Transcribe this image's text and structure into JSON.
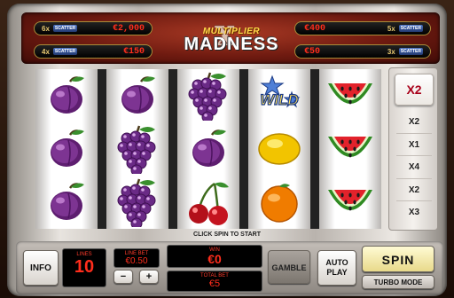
{
  "logo": {
    "line1": "MULTIPLIER",
    "line2": "MADNESS"
  },
  "paytable": {
    "left": [
      {
        "multiplier": "6x",
        "symbol": "SCATTER",
        "amount": "€2,000"
      },
      {
        "multiplier": "4x",
        "symbol": "SCATTER",
        "amount": "€150"
      }
    ],
    "right": [
      {
        "amount": "€400",
        "multiplier": "5x",
        "symbol": "SCATTER"
      },
      {
        "amount": "€50",
        "multiplier": "3x",
        "symbol": "SCATTER"
      }
    ]
  },
  "reels": [
    [
      "plum",
      "plum",
      "plum"
    ],
    [
      "plum",
      "grapes",
      "grapes"
    ],
    [
      "grapes",
      "plum",
      "cherries"
    ],
    [
      "wild",
      "lemon",
      "orange"
    ],
    [
      "watermelon",
      "watermelon",
      "watermelon"
    ]
  ],
  "wild_label": "WILD",
  "multiplier_panel": {
    "current": "X2",
    "upcoming": [
      "X2",
      "X1",
      "X4",
      "X2",
      "X3"
    ]
  },
  "hint": "CLICK SPIN TO START",
  "controls": {
    "info": "INFO",
    "lines_label": "LINES",
    "lines_value": "10",
    "line_bet_label": "LINE BET",
    "line_bet_value": "€0.50",
    "minus": "−",
    "plus": "+",
    "win_label": "WIN",
    "win_value": "€0",
    "total_bet_label": "TOTAL BET",
    "total_bet_value": "€5",
    "gamble": "GAMBLE",
    "auto_play_line1": "AUTO",
    "auto_play_line2": "PLAY",
    "spin": "SPIN",
    "turbo": "TURBO MODE"
  }
}
